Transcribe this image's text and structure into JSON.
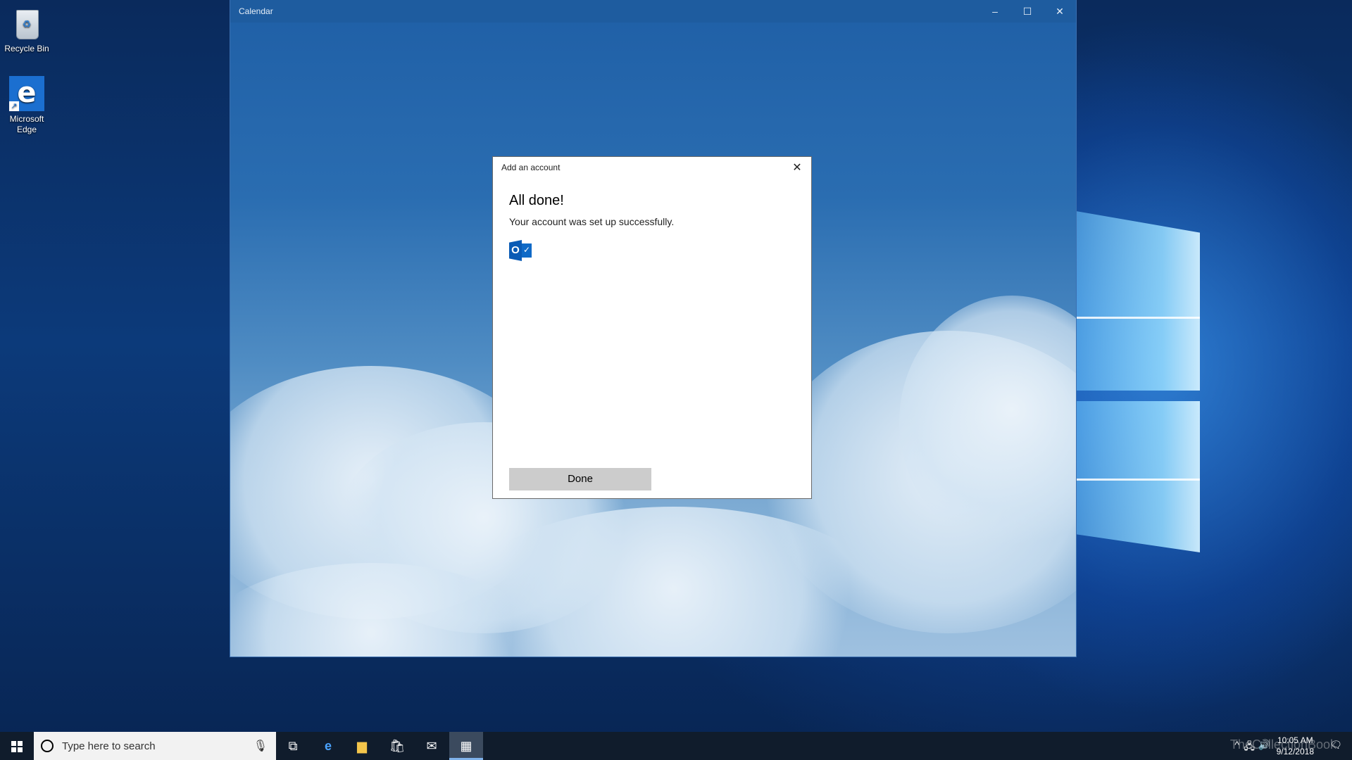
{
  "desktop": {
    "icons": [
      {
        "label": "Recycle Bin",
        "icon": "recycle-bin-icon"
      },
      {
        "label": "Microsoft Edge",
        "icon": "edge-icon"
      }
    ]
  },
  "window": {
    "title": "Calendar",
    "minimize_glyph": "–",
    "maximize_glyph": "☐",
    "close_glyph": "✕"
  },
  "dialog": {
    "title": "Add an account",
    "close_glyph": "✕",
    "heading": "All done!",
    "message": "Your account was set up successfully.",
    "account_icon": "outlook-icon",
    "outlook_letter": "O",
    "done_label": "Done"
  },
  "taskbar": {
    "search_placeholder": "Type here to search",
    "pinned": [
      "task-view-icon",
      "edge-icon",
      "file-explorer-icon",
      "store-icon",
      "mail-icon",
      "calendar-icon"
    ],
    "active_app": "calendar-icon",
    "clock_time": "10:05 AM",
    "clock_date": "9/12/2018",
    "watermark": "TheCollectionBook"
  },
  "colors": {
    "titlebar": "#1e5c9f",
    "taskbar": "#101c2c",
    "done_button": "#cccccc",
    "outlook_blue": "#0a5bb5"
  }
}
